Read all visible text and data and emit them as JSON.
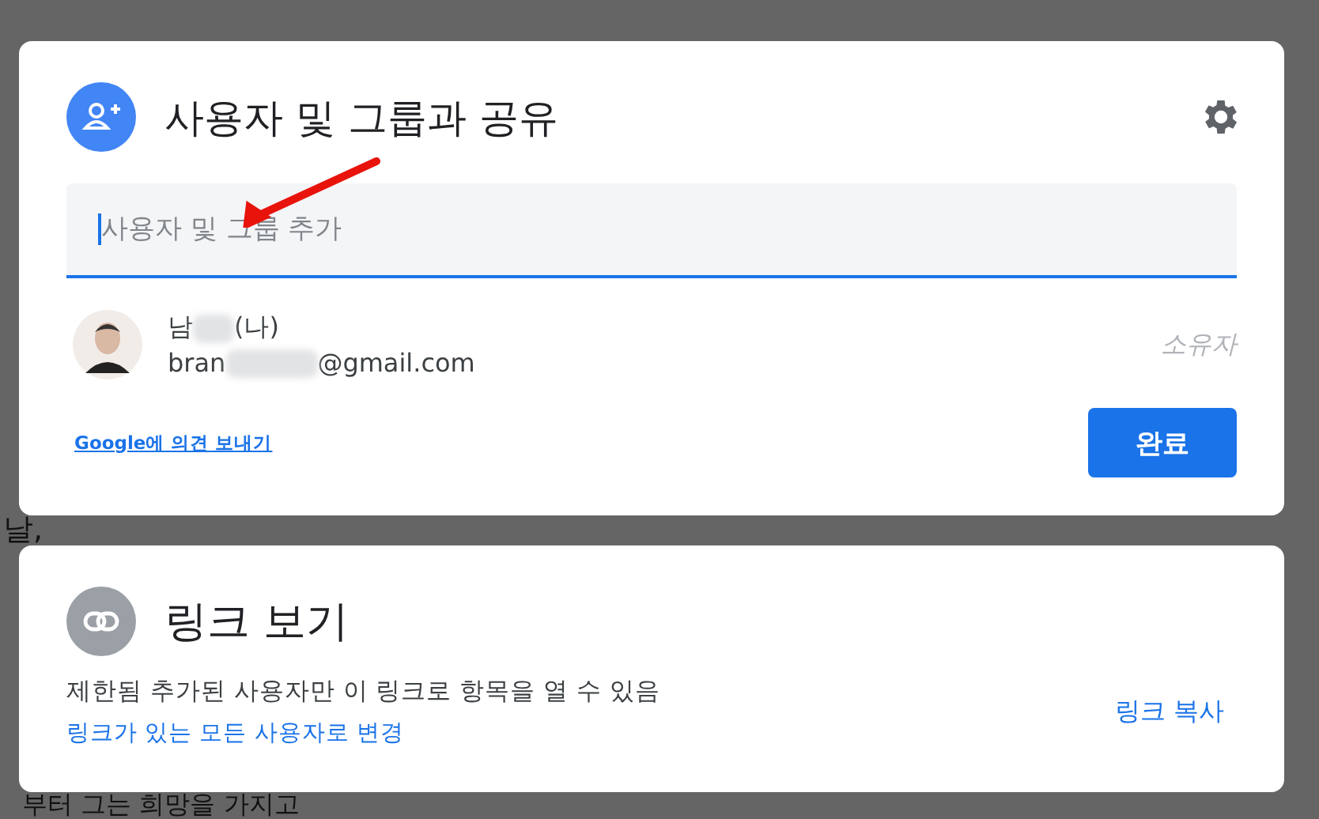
{
  "background_document": {
    "lines": [
      "날,",
      "부터 그는 희망을 가지고"
    ]
  },
  "share_dialog": {
    "title": "사용자 및 그룹과 공유",
    "input": {
      "placeholder": "사용자 및 그룹 추가",
      "focused": true
    },
    "people": [
      {
        "name_start": "남",
        "name_end": "(나)",
        "email_start": "bran",
        "email_end": "@gmail.com",
        "role": "소유자"
      }
    ],
    "feedback_link": "Google에 의견 보내기",
    "done_button": "완료"
  },
  "link_panel": {
    "title": "링크 보기",
    "description": "제한됨 추가된 사용자만 이 링크로 항목을 열 수 있음",
    "change_link": "링크가 있는 모든 사용자로 변경",
    "copy_link": "링크 복사"
  }
}
